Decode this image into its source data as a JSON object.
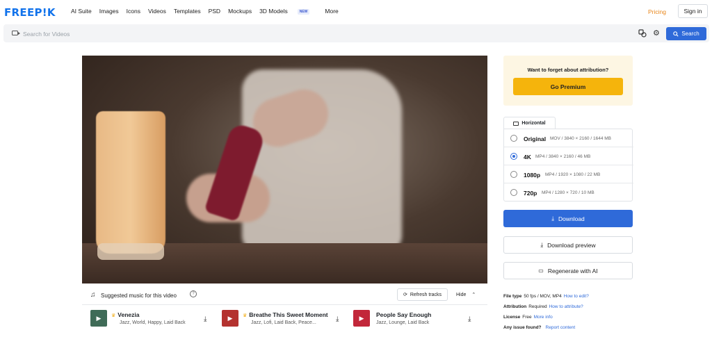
{
  "nav": {
    "logo": "FREEP!K",
    "links": [
      "AI Suite",
      "Images",
      "Icons",
      "Videos",
      "Templates",
      "PSD",
      "Mockups",
      "3D Models",
      "More"
    ],
    "new_badge": "NEW",
    "pricing": "Pricing",
    "signin": "Sign in"
  },
  "search": {
    "placeholder": "Search for Videos",
    "button": "Search"
  },
  "music": {
    "title": "Suggested music for this video",
    "refresh": "Refresh tracks",
    "hide": "Hide",
    "tracks": [
      {
        "name": "Venezia",
        "tags": "Jazz, World, Happy, Laid Back",
        "color": "#3f6b57"
      },
      {
        "name": "Breathe This Sweet Moment",
        "tags": "Jazz, Lofi, Laid Back, Peace...",
        "color": "#b4322f"
      },
      {
        "name": "People Say Enough",
        "tags": "Jazz, Lounge, Laid Back",
        "color": "#c2273a"
      }
    ]
  },
  "premium": {
    "question": "Want to forget about attribution?",
    "button": "Go Premium"
  },
  "orientation_tab": "Horizontal",
  "formats": [
    {
      "label": "Original",
      "meta": "MOV / 3840 × 2160 / 1644 MB",
      "selected": false
    },
    {
      "label": "4K",
      "meta": "MP4 / 3840 × 2160 / 46 MB",
      "selected": true
    },
    {
      "label": "1080p",
      "meta": "MP4 / 1920 × 1080 / 22 MB",
      "selected": false
    },
    {
      "label": "720p",
      "meta": "MP4 / 1280 × 720 / 10 MB",
      "selected": false
    }
  ],
  "actions": {
    "download": "Download",
    "download_preview": "Download preview",
    "regenerate": "Regenerate with AI"
  },
  "info": {
    "file_type_label": "File type",
    "file_type_value": "50 fps / MOV, MP4",
    "file_type_link": "How to edit?",
    "attribution_label": "Attribution",
    "attribution_value": "Required",
    "attribution_link": "How to attribute?",
    "license_label": "License",
    "license_value": "Free",
    "license_link": "More info",
    "issue_label": "Any issue found?",
    "issue_link": "Report content"
  },
  "colors": {
    "primary": "#2f6ad9",
    "premium": "#f5b40c",
    "pricing": "#e8861a"
  }
}
